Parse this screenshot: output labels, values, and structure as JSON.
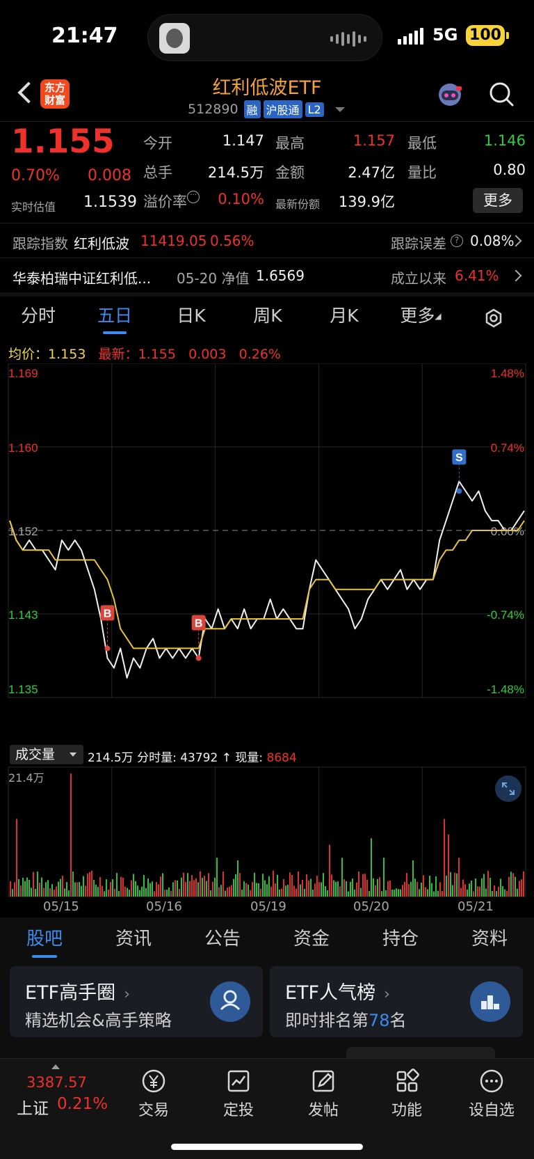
{
  "status": {
    "time": "21:47",
    "network": "5G",
    "battery": "100"
  },
  "header": {
    "logo_line1": "东方",
    "logo_line2": "财富",
    "title": "红利低波ETF",
    "code": "512890",
    "tags": [
      "融",
      "沪股通",
      "L2"
    ]
  },
  "quote": {
    "price": "1.155",
    "pct": "0.70%",
    "change": "0.008",
    "open_label": "今开",
    "open": "1.147",
    "high_label": "最高",
    "high": "1.157",
    "low_label": "最低",
    "low": "1.146",
    "volume_label": "总手",
    "volume": "214.5万",
    "amount_label": "金额",
    "amount": "2.47亿",
    "ratio_label": "量比",
    "ratio": "0.80",
    "est_label": "实时估值",
    "est": "1.1539",
    "premium_label": "溢价率",
    "premium": "0.10%",
    "shares_label": "最新份额",
    "shares": "139.9亿",
    "more_button": "更多"
  },
  "tracking": {
    "index_label": "跟踪指数",
    "index_name": "红利低波",
    "index_value": "11419.05",
    "index_pct": "0.56%",
    "error_label": "跟踪误差",
    "error_value": "0.08%"
  },
  "fund": {
    "name": "华泰柏瑞中证红利低...",
    "nav_label": "05-20 净值",
    "nav": "1.6569",
    "since_label": "成立以来",
    "since_pct": "6.41%"
  },
  "chart_tabs": [
    "分时",
    "五日",
    "日K",
    "周K",
    "月K",
    "更多"
  ],
  "chart_tab_active": 1,
  "legend": {
    "avg_label": "均价：",
    "avg": "1.153",
    "latest_label": "最新：",
    "latest": "1.155",
    "chg": "0.003",
    "pct": "0.26%"
  },
  "volume_panel": {
    "selector": "成交量",
    "info_total": "214.5万",
    "info_min_label": "分时量:",
    "info_min": "43792 ↑",
    "info_cur_label": "现量:",
    "info_cur": "8684",
    "max_label": "21.4万"
  },
  "chart_data": {
    "type": "line",
    "y_ticks_left": [
      "1.169",
      "1.160",
      "1.152",
      "1.143",
      "1.135"
    ],
    "y_ticks_right": [
      "1.48%",
      "0.74%",
      "0.00%",
      "-0.74%",
      "-1.48%"
    ],
    "ylim": [
      1.135,
      1.169
    ],
    "reference": 1.152,
    "x_labels": [
      "05/15",
      "05/16",
      "05/19",
      "05/20",
      "05/21"
    ],
    "series": [
      {
        "values": [
          1.153,
          1.151,
          1.15,
          1.151,
          1.15,
          1.15,
          1.149,
          1.148,
          1.151,
          1.15,
          1.151,
          1.15,
          1.148,
          1.146,
          1.143,
          1.139,
          1.138,
          1.14,
          1.137,
          1.139,
          1.138,
          1.14,
          1.141,
          1.139,
          1.14,
          1.139,
          1.14,
          1.139,
          1.14,
          1.139,
          1.143,
          1.142,
          1.144,
          1.142,
          1.143,
          1.142,
          1.144,
          1.142,
          1.143,
          1.143,
          1.145,
          1.143,
          1.144,
          1.143,
          1.142,
          1.142,
          1.146,
          1.149,
          1.148,
          1.147,
          1.146,
          1.145,
          1.144,
          1.142,
          1.143,
          1.145,
          1.146,
          1.147,
          1.146,
          1.147,
          1.148,
          1.146,
          1.147,
          1.146,
          1.147,
          1.147,
          1.151,
          1.153,
          1.155,
          1.157,
          1.156,
          1.155,
          1.156,
          1.154,
          1.153,
          1.153,
          1.152,
          1.152,
          1.153,
          1.154
        ]
      },
      {
        "values": [
          1.153,
          1.151,
          1.15,
          1.15,
          1.15,
          1.15,
          1.15,
          1.149,
          1.149,
          1.149,
          1.149,
          1.149,
          1.149,
          1.149,
          1.148,
          1.147,
          1.145,
          1.142,
          1.141,
          1.14,
          1.14,
          1.14,
          1.14,
          1.14,
          1.14,
          1.14,
          1.14,
          1.14,
          1.14,
          1.14,
          1.142,
          1.142,
          1.142,
          1.142,
          1.143,
          1.143,
          1.143,
          1.143,
          1.143,
          1.143,
          1.143,
          1.143,
          1.143,
          1.143,
          1.143,
          1.143,
          1.146,
          1.147,
          1.147,
          1.147,
          1.146,
          1.146,
          1.146,
          1.146,
          1.146,
          1.146,
          1.146,
          1.147,
          1.147,
          1.147,
          1.147,
          1.147,
          1.147,
          1.147,
          1.147,
          1.147,
          1.149,
          1.15,
          1.15,
          1.151,
          1.151,
          1.152,
          1.152,
          1.152,
          1.152,
          1.152,
          1.152,
          1.152,
          1.152,
          1.153
        ]
      }
    ],
    "markers": [
      {
        "label": "B",
        "index": 15,
        "value": 1.14,
        "color": "#d9463c"
      },
      {
        "label": "B",
        "index": 29,
        "value": 1.139,
        "color": "#d9463c"
      },
      {
        "label": "S",
        "index": 69,
        "value": 1.156,
        "color": "#2f6fc9"
      }
    ],
    "volume_max": 214000,
    "grid": true
  },
  "section_tabs": [
    "股吧",
    "资讯",
    "公告",
    "资金",
    "持仓",
    "资料"
  ],
  "section_tab_active": 0,
  "cards": [
    {
      "title": "ETF高手圈",
      "subtitle": "精选机会&高手策略"
    },
    {
      "title": "ETF人气榜",
      "subtitle_pre": "即时排名第",
      "rank": "78",
      "subtitle_post": "名"
    }
  ],
  "bottom_index": {
    "value": "3387.57",
    "name": "上证",
    "pct": "0.21%"
  },
  "bottom_nav": [
    {
      "label": "交易",
      "icon": "yen-coin-icon"
    },
    {
      "label": "定投",
      "icon": "chart-frame-icon"
    },
    {
      "label": "发帖",
      "icon": "edit-icon"
    },
    {
      "label": "功能",
      "icon": "grid-icon"
    },
    {
      "label": "设自选",
      "icon": "more-circle-icon"
    }
  ]
}
